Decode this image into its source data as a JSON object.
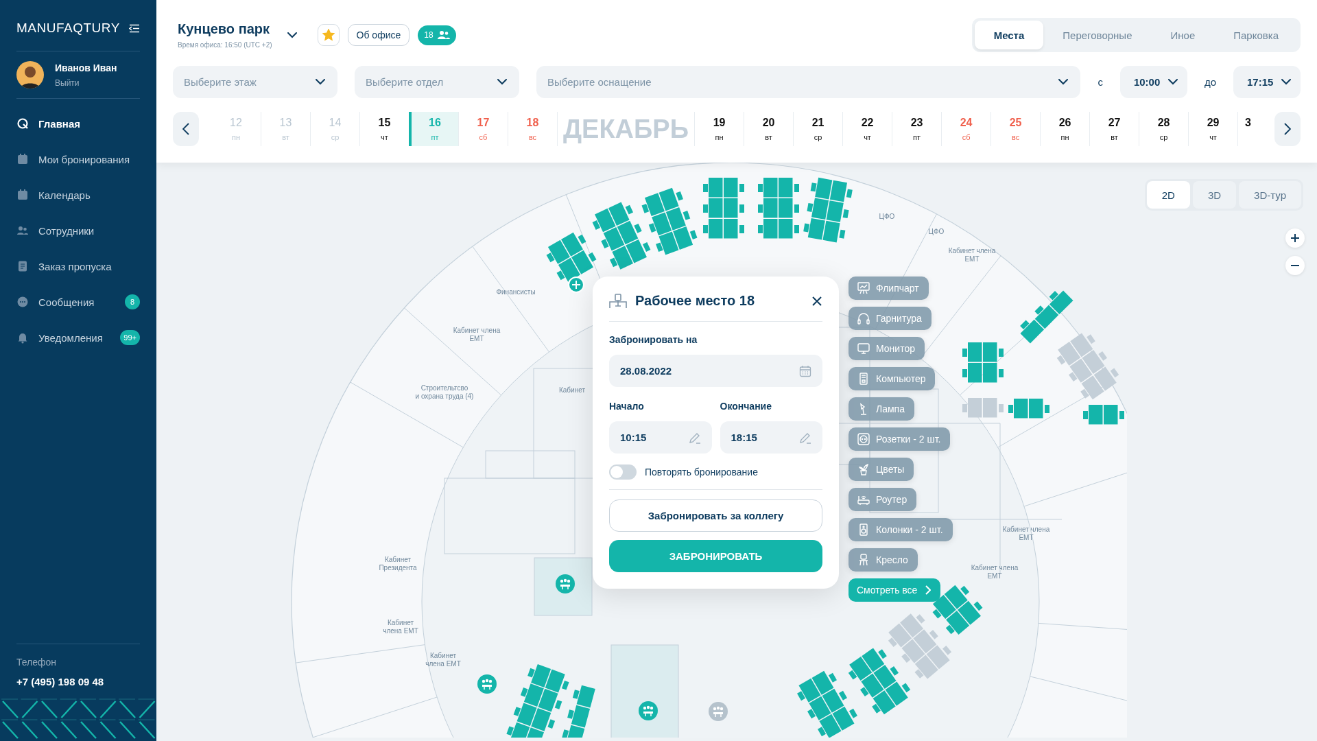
{
  "sidebar": {
    "logo": "MANUFAQTURY",
    "user": {
      "name": "Иванов Иван",
      "action": "Выйти"
    },
    "nav": [
      {
        "label": "Главная",
        "selected": true
      },
      {
        "label": "Мои бронирования",
        "selected": false
      },
      {
        "label": "Календарь",
        "selected": false
      },
      {
        "label": "Сотрудники",
        "selected": false
      },
      {
        "label": "Заказ пропуска",
        "selected": false
      },
      {
        "label": "Сообщения",
        "selected": false,
        "badge": "8"
      },
      {
        "label": "Уведомления",
        "selected": false,
        "badge": "99+"
      }
    ],
    "contact": {
      "label": "Телефон",
      "value": "+7 (495) 198 09 48"
    }
  },
  "header": {
    "office": {
      "name": "Кунцево парк",
      "time": "Время офиса: 16:50 (UTC +2)"
    },
    "favorite": true,
    "about_button": "Об офисе",
    "people_count": "18",
    "tabs": [
      {
        "label": "Места",
        "selected": true
      },
      {
        "label": "Переговорные",
        "selected": false
      },
      {
        "label": "Иное",
        "selected": false
      },
      {
        "label": "Парковка",
        "selected": false
      }
    ],
    "filters": {
      "floor": {
        "placeholder": "Выберите этаж"
      },
      "department": {
        "placeholder": "Выберите отдел"
      },
      "equipment": {
        "placeholder": "Выберите оснащение"
      },
      "time_from": {
        "label": "с",
        "value": "10:00"
      },
      "time_to": {
        "label": "до",
        "value": "17:15"
      }
    },
    "calendar": {
      "month": "ДЕКАБРЬ",
      "days": [
        {
          "day": "12",
          "weekday": "пн",
          "kind": "past",
          "selected": false
        },
        {
          "day": "13",
          "weekday": "вт",
          "kind": "past",
          "selected": false
        },
        {
          "day": "14",
          "weekday": "ср",
          "kind": "past",
          "selected": false
        },
        {
          "day": "15",
          "weekday": "чт",
          "kind": "workday",
          "selected": false
        },
        {
          "day": "16",
          "weekday": "пт",
          "kind": "workday",
          "selected": true
        },
        {
          "day": "17",
          "weekday": "сб",
          "kind": "weekend",
          "selected": false
        },
        {
          "day": "18",
          "weekday": "вс",
          "kind": "weekend",
          "selected": false
        },
        {
          "day": "19",
          "weekday": "пн",
          "kind": "workday",
          "selected": false
        },
        {
          "day": "20",
          "weekday": "вт",
          "kind": "workday",
          "selected": false
        },
        {
          "day": "21",
          "weekday": "ср",
          "kind": "workday",
          "selected": false
        },
        {
          "day": "22",
          "weekday": "чт",
          "kind": "workday",
          "selected": false
        },
        {
          "day": "23",
          "weekday": "пт",
          "kind": "workday",
          "selected": false
        },
        {
          "day": "24",
          "weekday": "сб",
          "kind": "weekend",
          "selected": false
        },
        {
          "day": "25",
          "weekday": "вс",
          "kind": "weekend",
          "selected": false
        },
        {
          "day": "26",
          "weekday": "пн",
          "kind": "workday",
          "selected": false
        },
        {
          "day": "27",
          "weekday": "вт",
          "kind": "workday",
          "selected": false
        },
        {
          "day": "28",
          "weekday": "ср",
          "kind": "workday",
          "selected": false
        },
        {
          "day": "29",
          "weekday": "чт",
          "kind": "workday",
          "selected": false
        },
        {
          "day": "3",
          "kind": "workday",
          "selected": false
        }
      ]
    }
  },
  "map": {
    "view_modes": [
      {
        "label": "2D",
        "selected": true
      },
      {
        "label": "3D",
        "selected": false
      },
      {
        "label": "3D-тур",
        "selected": false
      }
    ],
    "rooms": [
      {
        "lines": [
          "Финансисты"
        ]
      },
      {
        "lines": [
          "Кабинет члена",
          "ЕМТ"
        ]
      },
      {
        "lines": [
          "Строительтсво",
          "и охрана труда (4)"
        ]
      },
      {
        "lines": [
          "Кабинет"
        ]
      },
      {
        "lines": [
          "Кабинет",
          "Президента"
        ]
      },
      {
        "lines": [
          "Кабинет",
          "члена ЕМТ"
        ]
      },
      {
        "lines": [
          "Кабинет",
          "члена ЕМТ"
        ]
      },
      {
        "lines": [
          "ЦФО"
        ]
      },
      {
        "lines": [
          "ЦФО"
        ]
      },
      {
        "lines": [
          "Кабинет члена",
          "ЕМТ"
        ]
      },
      {
        "lines": [
          "Кабинет члена",
          "ЕМТ"
        ]
      },
      {
        "lines": [
          "Кабинет члена",
          "ЕМТ"
        ]
      }
    ],
    "desks": [
      {
        "available": true
      },
      {
        "available": true
      },
      {
        "available": true
      },
      {
        "available": true
      },
      {
        "available": true
      },
      {
        "available": true
      },
      {
        "available": true
      },
      {
        "available": true
      },
      {
        "available": false
      },
      {
        "available": true
      },
      {
        "available": true
      },
      {
        "available": false
      },
      {
        "available": true
      },
      {
        "available": false
      },
      {
        "available": true
      },
      {
        "available": true
      },
      {
        "available": true
      },
      {
        "available": true
      }
    ],
    "booking": {
      "title": "Рабочее место 18",
      "date_label": "Забронировать на",
      "date": "28.08.2022",
      "start_label": "Начало",
      "start": "10:15",
      "end_label": "Окончание",
      "end": "18:15",
      "repeat": {
        "label": "Повторять бронирование",
        "on": false
      },
      "colleague_button": "Забронировать за коллегу",
      "book_button": "ЗАБРОНИРОВАТЬ"
    },
    "equipment": [
      {
        "label": "Флипчарт"
      },
      {
        "label": "Гарнитура"
      },
      {
        "label": "Монитор"
      },
      {
        "label": "Компьютер"
      },
      {
        "label": "Лампа"
      },
      {
        "label": "Розетки - 2 шт."
      },
      {
        "label": "Цветы"
      },
      {
        "label": "Роутер"
      },
      {
        "label": "Колонки - 2 шт."
      },
      {
        "label": "Кресло"
      }
    ],
    "show_all": "Смотреть все"
  }
}
